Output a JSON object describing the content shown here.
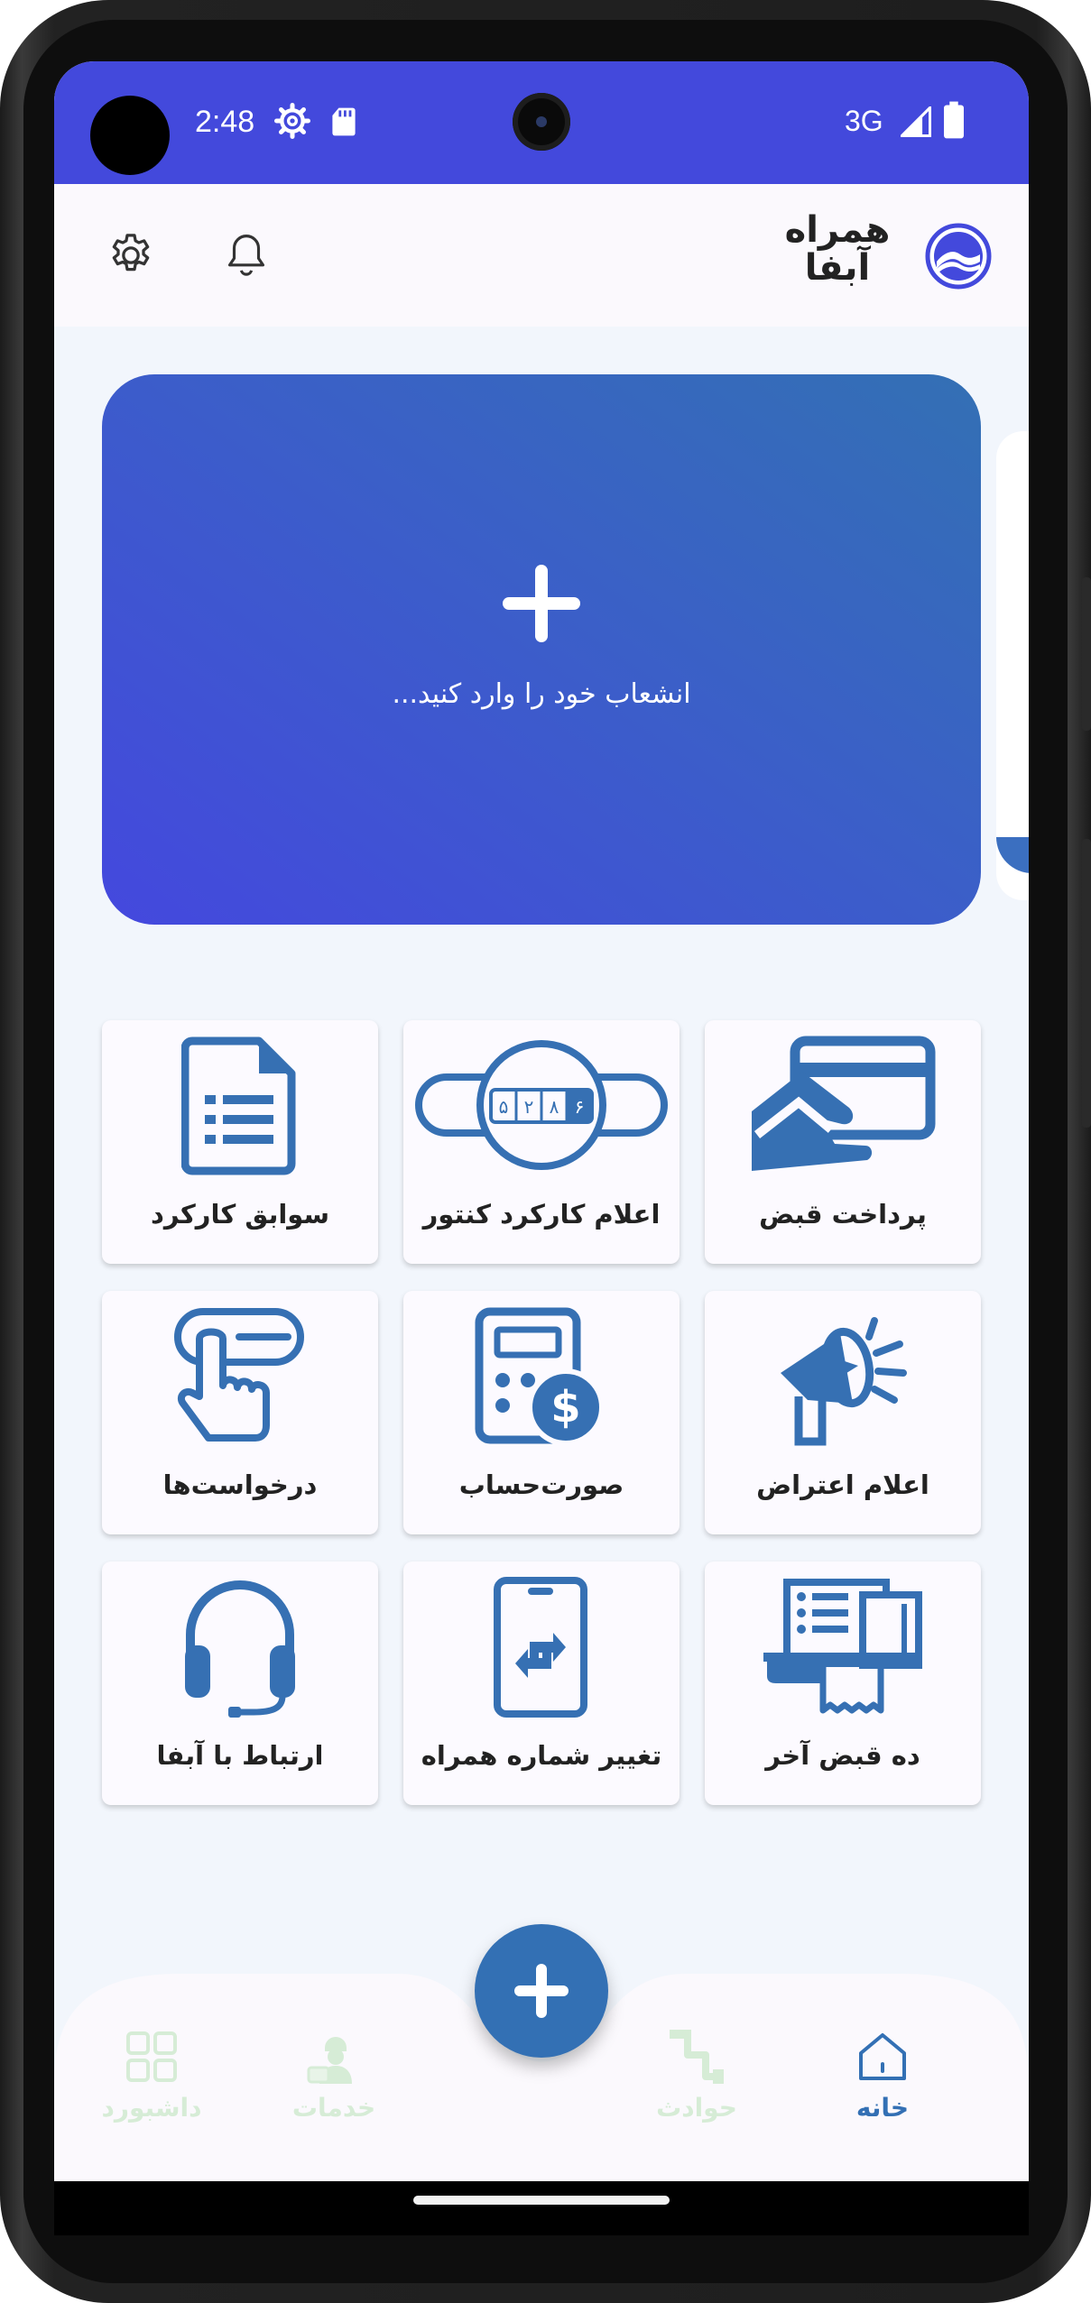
{
  "status_bar": {
    "time": "2:48",
    "network": "3G",
    "icons": [
      "settings-gear-icon",
      "sd-card-icon",
      "signal-icon",
      "battery-icon"
    ]
  },
  "header": {
    "logo_text_line1": "همراه",
    "logo_text_line2": "آبفا",
    "icons": [
      "settings-icon",
      "bell-icon",
      "abfa-logo-icon"
    ]
  },
  "hero": {
    "text": "انشعاب خود را وارد کنید...",
    "icon": "plus-icon"
  },
  "services": [
    {
      "id": "bill-payment",
      "label": "پرداخت قبض",
      "icon": "card-hand-icon"
    },
    {
      "id": "meter-reading",
      "label": "اعلام کارکرد کنتور",
      "icon": "water-meter-icon"
    },
    {
      "id": "usage-history",
      "label": "سوابق کارکرد",
      "icon": "document-list-icon"
    },
    {
      "id": "complaint",
      "label": "اعلام اعتراض",
      "icon": "megaphone-icon"
    },
    {
      "id": "invoice",
      "label": "صورت‌حساب",
      "icon": "calculator-dollar-icon"
    },
    {
      "id": "requests",
      "label": "درخواست‌ها",
      "icon": "hand-pointer-icon"
    },
    {
      "id": "last-ten-bills",
      "label": "ده قبض آخر",
      "icon": "printer-receipt-icon"
    },
    {
      "id": "change-phone",
      "label": "تغییر شماره همراه",
      "icon": "phone-swap-icon"
    },
    {
      "id": "contact-abfa",
      "label": "ارتباط با آبفا",
      "icon": "headset-icon"
    }
  ],
  "meter_digits": "۵۲۸۶",
  "bottom_nav": {
    "items": [
      {
        "id": "dashboard",
        "label": "داشبورد",
        "icon": "grid-icon",
        "active": false
      },
      {
        "id": "services",
        "label": "خدمات",
        "icon": "worker-icon",
        "active": false
      },
      {
        "id": "incidents",
        "label": "حوادث",
        "icon": "pipe-icon",
        "active": false
      },
      {
        "id": "home",
        "label": "خانه",
        "icon": "home-icon",
        "active": true
      }
    ],
    "fab_icon": "plus-icon"
  },
  "colors": {
    "primary": "#4349dc",
    "accent_blue": "#3370b4",
    "icon_blue": "#3670b3",
    "nav_inactive": "#d6ecd6",
    "background": "#f2f6fc"
  }
}
